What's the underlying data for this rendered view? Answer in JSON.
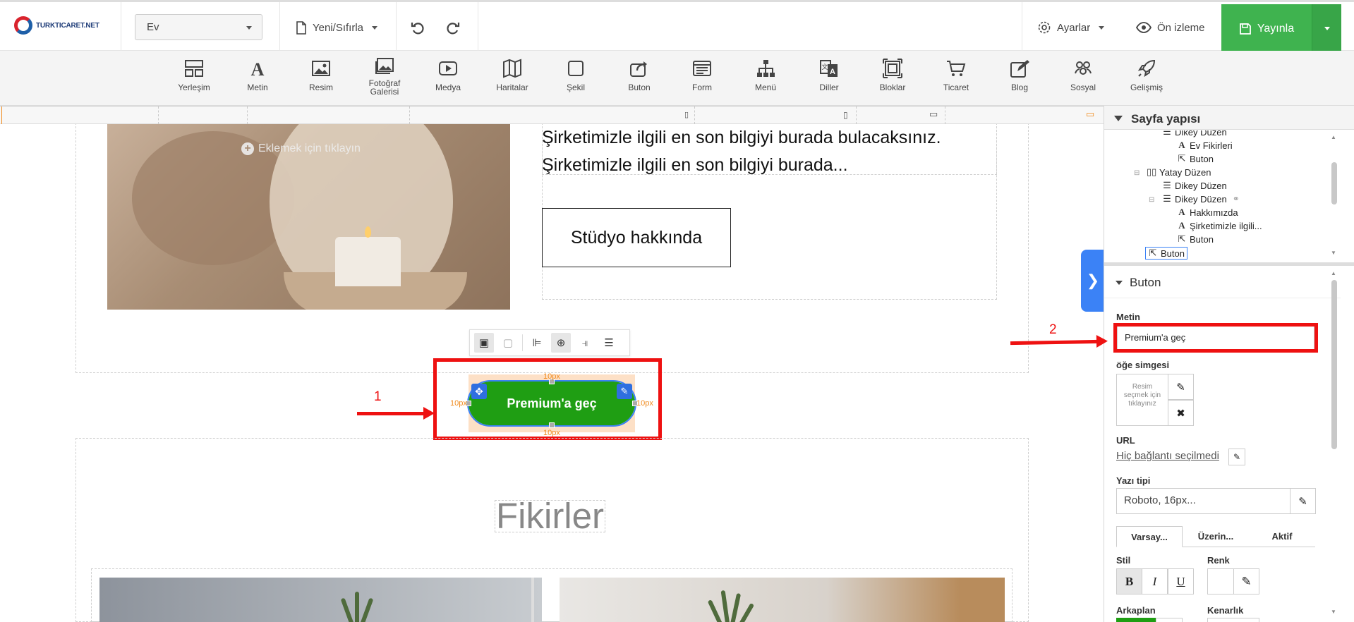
{
  "header": {
    "logo_text": "TURKTICARET.NET",
    "page_select": "Ev",
    "reset_label": "Yeni/Sıfırla",
    "settings_label": "Ayarlar",
    "preview_label": "Ön izleme",
    "publish_label": "Yayınla"
  },
  "toolbar": {
    "items": [
      {
        "label": "Yerleşim",
        "icon": "layout-icon"
      },
      {
        "label": "Metin",
        "icon": "text-icon"
      },
      {
        "label": "Resim",
        "icon": "image-icon"
      },
      {
        "label": "Fotoğraf Galerisi",
        "icon": "gallery-icon"
      },
      {
        "label": "Medya",
        "icon": "media-icon"
      },
      {
        "label": "Haritalar",
        "icon": "map-icon"
      },
      {
        "label": "Şekil",
        "icon": "shape-icon"
      },
      {
        "label": "Buton",
        "icon": "button-icon"
      },
      {
        "label": "Form",
        "icon": "form-icon"
      },
      {
        "label": "Menü",
        "icon": "menu-icon"
      },
      {
        "label": "Diller",
        "icon": "languages-icon"
      },
      {
        "label": "Bloklar",
        "icon": "blocks-icon"
      },
      {
        "label": "Ticaret",
        "icon": "cart-icon"
      },
      {
        "label": "Blog",
        "icon": "blog-icon"
      },
      {
        "label": "Sosyal",
        "icon": "social-icon"
      },
      {
        "label": "Gelişmiş",
        "icon": "rocket-icon"
      }
    ]
  },
  "canvas": {
    "add_image_hint": "Eklemek için tıklayın",
    "hero_text_line1": "Şirketimizle ilgili en son bilgiyi burada bulacaksınız.",
    "hero_text_line2": "Şirketimizle ilgili en son bilgiyi burada...",
    "studio_button": "Stüdyo hakkında",
    "selected_button": "Premium'a geç",
    "padding_label": "10px",
    "section_title": "Fikirler",
    "annotation_1": "1",
    "annotation_2": "2"
  },
  "panel": {
    "structure_title": "Sayfa yapısı",
    "tree": [
      {
        "label": "Dikey Düzen",
        "icon": "vertical-layout-icon"
      },
      {
        "label": "Ev Fikirleri",
        "icon": "text-icon"
      },
      {
        "label": "Buton",
        "icon": "button-icon"
      },
      {
        "label": "Yatay Düzen",
        "icon": "horizontal-layout-icon"
      },
      {
        "label": "Dikey Düzen",
        "icon": "vertical-layout-icon"
      },
      {
        "label": "Dikey Düzen",
        "icon": "vertical-layout-icon"
      },
      {
        "label": "Hakkımızda",
        "icon": "text-icon"
      },
      {
        "label": "Şirketimizle ilgili...",
        "icon": "text-icon"
      },
      {
        "label": "Buton",
        "icon": "button-icon"
      },
      {
        "label": "Buton",
        "icon": "button-icon"
      }
    ],
    "button_section_title": "Buton",
    "text_label": "Metin",
    "text_value": "Premium'a geç",
    "icon_label": "öğe simgesi",
    "icon_placeholder": "Resim seçmek için tıklayınız",
    "url_label": "URL",
    "url_value": "Hiç bağlantı seçilmedi",
    "font_label": "Yazı tipi",
    "font_value": "Roboto, 16px...",
    "tabs": [
      "Varsay...",
      "Üzerin...",
      "Aktif"
    ],
    "style_label": "Stil",
    "color_label": "Renk",
    "background_label": "Arkaplan",
    "border_label": "Kenarlık",
    "accent_color": "#3fb34f",
    "button_color": "#1f9e13",
    "annotation_color": "#ee1111"
  }
}
